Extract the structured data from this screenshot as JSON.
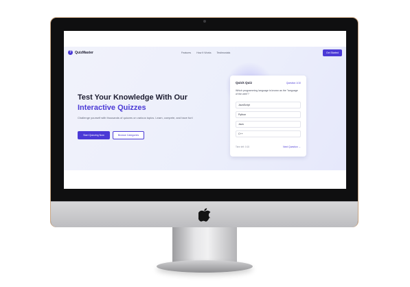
{
  "brand": {
    "name": "QuizMaster",
    "icon": "question-icon",
    "icon_glyph": "?"
  },
  "nav": {
    "links": [
      "Features",
      "How It Works",
      "Testimonials"
    ],
    "cta_label": "Get Started"
  },
  "hero": {
    "title_line1": "Test Your Knowledge With Our",
    "title_accent": "Interactive Quizzes",
    "subtitle": "Challenge yourself with thousands of quizzes on various topics. Learn, compete, and have fun!",
    "primary_button": "Start Quizzing Now",
    "secondary_button": "Browse Categories"
  },
  "quiz": {
    "title": "Quick Quiz",
    "counter": "Question 1/10",
    "question": "Which programming language is known as the \"language of the web\"?",
    "options": [
      "JavaScript",
      "Python",
      "Java",
      "C++"
    ],
    "timer": "Time left: 0:15",
    "next_label": "Next Question →"
  },
  "colors": {
    "accent": "#4b3ad6",
    "text": "#1b1b2f",
    "hero_bg": "#eceffb",
    "frame_edge": "#c9a582"
  }
}
